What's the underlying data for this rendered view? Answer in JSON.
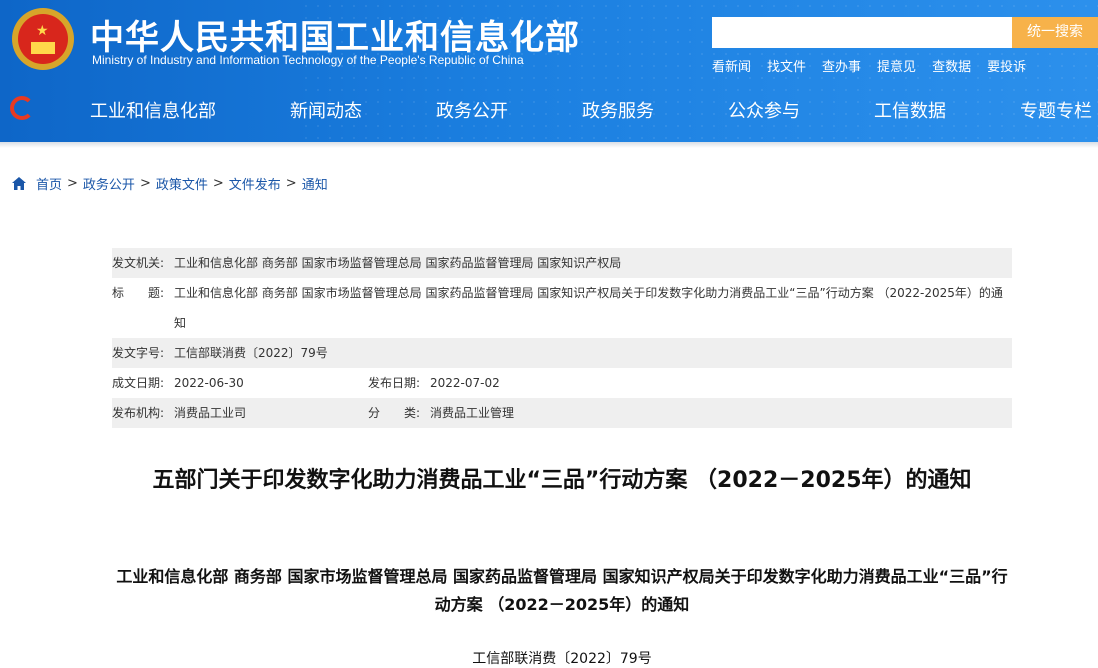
{
  "header": {
    "title": "中华人民共和国工业和信息化部",
    "subtitle": "Ministry of Industry and Information Technology of the People's Republic of China",
    "search_button": "统一搜索",
    "search_placeholder": "",
    "quick_links": [
      "看新闻",
      "找文件",
      "查办事",
      "提意见",
      "查数据",
      "要投诉"
    ]
  },
  "nav": {
    "items": [
      "工业和信息化部",
      "新闻动态",
      "政务公开",
      "政务服务",
      "公众参与",
      "工信数据",
      "专题专栏"
    ]
  },
  "breadcrumb": [
    "首页",
    "政务公开",
    "政策文件",
    "文件发布",
    "通知"
  ],
  "meta": {
    "issuer_label": "发文机关:",
    "issuer": "工业和信息化部 商务部 国家市场监督管理总局 国家药品监督管理局 国家知识产权局",
    "title_label": "标　　题:",
    "title": "工业和信息化部 商务部 国家市场监督管理总局 国家药品监督管理局 国家知识产权局关于印发数字化助力消费品工业“三品”行动方案 （2022-2025年）的通知",
    "doc_no_label": "发文字号:",
    "doc_no": "工信部联消费〔2022〕79号",
    "created_label": "成文日期:",
    "created": "2022-06-30",
    "published_label": "发布日期:",
    "published": "2022-07-02",
    "org_label": "发布机构:",
    "org": "消费品工业司",
    "category_label": "分　　类:",
    "category": "消费品工业管理"
  },
  "article": {
    "title": "五部门关于印发数字化助力消费品工业“三品”行动方案 （2022－2025年）的通知",
    "subtitle": "工业和信息化部 商务部 国家市场监督管理总局 国家药品监督管理局 国家知识产权局关于印发数字化助力消费品工业“三品”行动方案 （2022－2025年）的通知",
    "doc_number": "工信部联消费〔2022〕79号"
  },
  "colors": {
    "header_blue": "#1677d9",
    "search_orange": "#f7b24a",
    "link_blue": "#1a56a8",
    "meta_grey": "#efefef"
  }
}
